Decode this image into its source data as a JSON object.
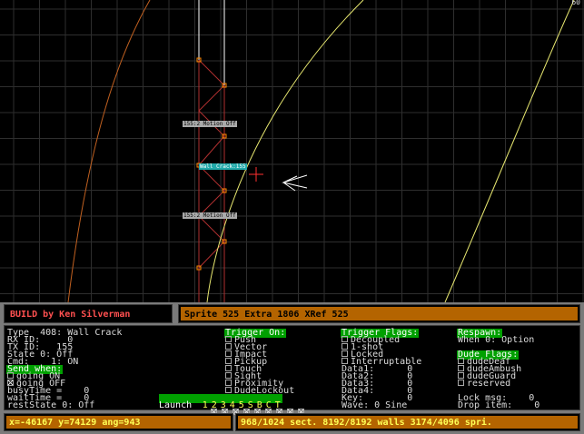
{
  "viewport": {
    "zoom_readout": "60",
    "tags": {
      "upper_wall": "155:2 Motion Off",
      "sprite": "Wall Crack:155",
      "lower_wall": "155:2 Motion Off"
    }
  },
  "header": {
    "title": "BUILD by Ken Silverman",
    "sprite_info": "Sprite 525  Extra 1806 XRef 525"
  },
  "left_col": {
    "type": "Type  408: Wall Crack",
    "rx": "RX ID:     0",
    "tx": "TX ID:   155",
    "state": "State 0: Off",
    "cmd": "Cmd:    1: ON",
    "send_when_header": "Send when:",
    "going_on": "going ON",
    "going_off": "going OFF",
    "busytime": "busyTime =    0",
    "waittime": "waitTime =    0",
    "reststate": "restState 0: Off"
  },
  "trigger_on": {
    "header": "Trigger On:",
    "items": [
      "Push",
      "Vector",
      "Impact",
      "Pickup",
      "Touch",
      "Sight",
      "Proximity",
      "DudeLockout"
    ]
  },
  "launch": {
    "label": "Launch",
    "keys": [
      "1",
      "2",
      "3",
      "4",
      "5",
      "S",
      "B",
      "C",
      "T"
    ]
  },
  "trigger_flags": {
    "header": "Trigger Flags:",
    "items": [
      "Decoupled",
      "1-shot",
      "Locked",
      "Interruptable"
    ],
    "data1": "Data1:      0",
    "data2": "Data2:      0",
    "data3": "Data3:      0",
    "data4": "Data4:      0",
    "key": "Key:        0",
    "wave": "Wave: 0 Sine"
  },
  "right_col": {
    "respawn_header": "Respawn:",
    "respawn_value": "When 0: Option",
    "dude_flags_header": "Dude Flags:",
    "dude_flags": [
      "dudeDeaf",
      "dudeAmbush",
      "dudeGuard",
      "reserved"
    ],
    "lock_msg": "Lock msg:    0",
    "drop_item": "Drop item:    0"
  },
  "status": {
    "coords": "x=-46167 y=74129 ang=943",
    "counts": "968/1024 sect. 8192/8192 walls 3174/4096 spri."
  },
  "colors": {
    "grid": "#2e2e2e",
    "wall_red": "#b03030",
    "wall_white": "#ffffff",
    "line_yellow": "#e8e870",
    "line_orange": "#c06020",
    "panel_gray": "#7a7a7a",
    "header_green": "#00a000",
    "status_yellow": "#ffff55"
  }
}
